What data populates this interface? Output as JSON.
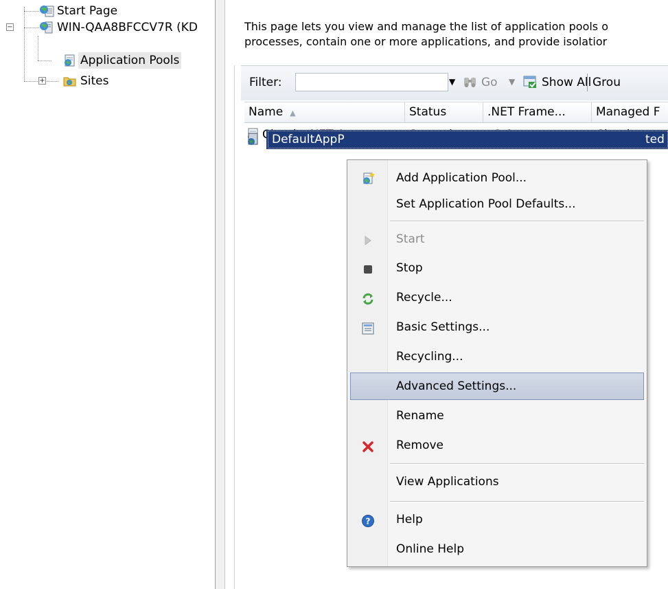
{
  "tree": {
    "items": [
      {
        "label": "Start Page",
        "icon": "start-page-icon"
      },
      {
        "label": "WIN-QAA8BFCCV7R (KD",
        "icon": "server-icon",
        "expander": "−"
      },
      {
        "label": "Application Pools",
        "icon": "application-pools-icon",
        "selected": true
      },
      {
        "label": "Sites",
        "icon": "sites-folder-icon",
        "expander": "+"
      }
    ]
  },
  "main": {
    "description_line1": "This page lets you view and manage the list of application pools o",
    "description_line2": "processes, contain one or more applications, and provide isolatior",
    "toolbar": {
      "filter_label": "Filter:",
      "filter_value": "",
      "go_label": "Go",
      "show_all_label": "Show All",
      "group_label": "Grou"
    },
    "columns": [
      "Name",
      ".NET Frame...",
      "Status",
      "Managed F"
    ],
    "rows": [
      {
        "name": "Classic .NET App...",
        "status": "Started",
        "framework": "v2.0",
        "pipeline": "Classic"
      },
      {
        "name": "DefaultAppP",
        "status": "",
        "framework": "",
        "pipeline": "ted"
      }
    ]
  },
  "context_menu": {
    "items": [
      {
        "label": "Add Application Pool...",
        "icon": "add-app-pool-icon"
      },
      {
        "label": "Set Application Pool Defaults...",
        "icon": ""
      },
      {
        "label": "Start",
        "icon": "start-icon",
        "disabled": true
      },
      {
        "label": "Stop",
        "icon": "stop-icon"
      },
      {
        "label": "Recycle...",
        "icon": "recycle-icon"
      },
      {
        "label": "Basic Settings...",
        "icon": "basic-settings-icon"
      },
      {
        "label": "Recycling...",
        "icon": ""
      },
      {
        "label": "Advanced Settings...",
        "icon": "",
        "highlighted": true
      },
      {
        "label": "Rename",
        "icon": ""
      },
      {
        "label": "Remove",
        "icon": "remove-icon"
      },
      {
        "label": "View Applications",
        "icon": ""
      },
      {
        "label": "Help",
        "icon": "help-icon"
      },
      {
        "label": "Online Help",
        "icon": ""
      }
    ]
  },
  "colors": {
    "selection": "#1c3a7a",
    "menu_hover": "#c8d0e0",
    "remove_red": "#d9252a"
  }
}
